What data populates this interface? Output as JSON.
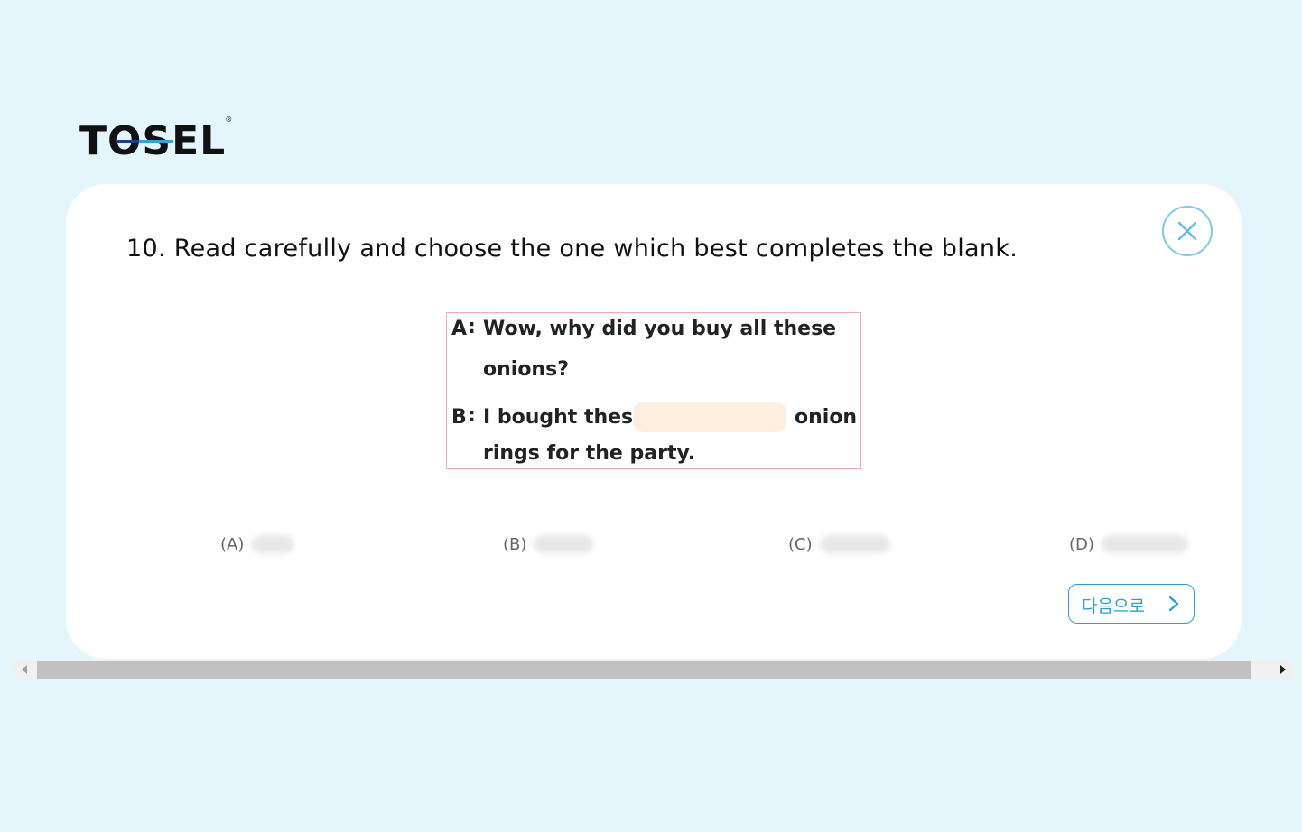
{
  "logo": {
    "text": "TOSEL",
    "registered": "®"
  },
  "question": {
    "text": "10. Read carefully and choose the one which best completes the blank."
  },
  "close_button": {
    "icon": "close-icon"
  },
  "dialog": {
    "a_speaker": "A",
    "a_colon": ":",
    "a_line1": "Wow, why did you buy all these",
    "a_line2": "onions?",
    "b_speaker": "B",
    "b_colon": ":",
    "b_before_blank": "I bought these",
    "b_after_blank": "onion",
    "b_line2": "rings for the party."
  },
  "options": [
    {
      "label": "(A)"
    },
    {
      "label": "(B)"
    },
    {
      "label": "(C)"
    },
    {
      "label": "(D)"
    }
  ],
  "next_button": {
    "label": "다음으로",
    "icon": "chevron-right-icon"
  },
  "colors": {
    "background": "#e4f6fb",
    "accent": "#2f9fd3",
    "dialog_border": "#f2a9c8",
    "blank_fill": "#fdeee0"
  }
}
